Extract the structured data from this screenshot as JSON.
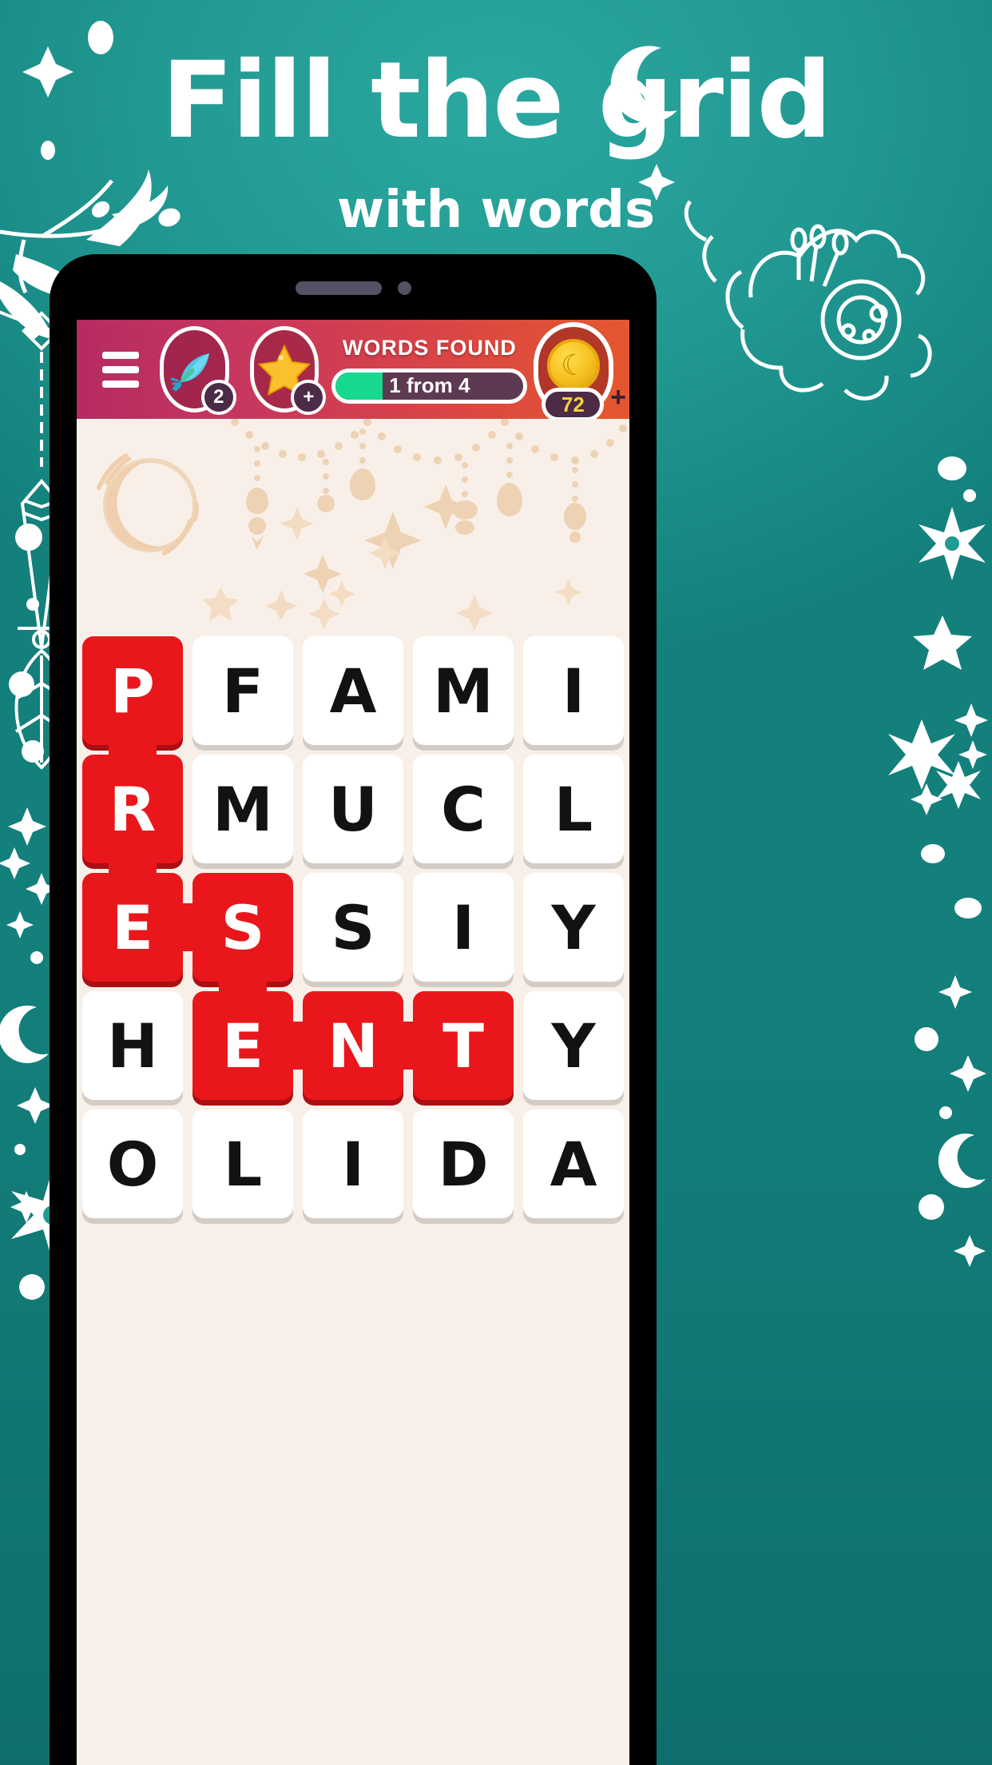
{
  "promo": {
    "title_line1": "Fill the grid",
    "title_line2": "with words",
    "background_color": "#219a93",
    "accent_white": "#ffffff"
  },
  "game": {
    "topbar": {
      "menu_icon": "hamburger-icon",
      "feather_powerup": {
        "icon": "feather-icon",
        "count": "2"
      },
      "star_powerup": {
        "icon": "star-icon",
        "badge": "+"
      },
      "words_found_label": "WORDS FOUND",
      "progress_text": "1 from 4",
      "progress_percent": 25,
      "progress_fill_color": "#17d98e",
      "coins": {
        "icon": "coin-moon-icon",
        "amount": "72",
        "add_label": "+"
      }
    },
    "board": {
      "decor_moon": "crescent-moon-decoration",
      "decor_garland": "hanging-beads-decoration",
      "columns": 5,
      "rows": 5,
      "found_color": "#e9171b",
      "tile_color": "#ffffff",
      "grid": [
        [
          {
            "letter": "P",
            "found": true,
            "join_right": false,
            "join_down": true
          },
          {
            "letter": "F",
            "found": false,
            "join_right": false,
            "join_down": false
          },
          {
            "letter": "A",
            "found": false,
            "join_right": false,
            "join_down": false
          },
          {
            "letter": "M",
            "found": false,
            "join_right": false,
            "join_down": false
          },
          {
            "letter": "I",
            "found": false,
            "join_right": false,
            "join_down": false
          }
        ],
        [
          {
            "letter": "R",
            "found": true,
            "join_right": false,
            "join_down": true
          },
          {
            "letter": "M",
            "found": false,
            "join_right": false,
            "join_down": false
          },
          {
            "letter": "U",
            "found": false,
            "join_right": false,
            "join_down": false
          },
          {
            "letter": "C",
            "found": false,
            "join_right": false,
            "join_down": false
          },
          {
            "letter": "L",
            "found": false,
            "join_right": false,
            "join_down": false
          }
        ],
        [
          {
            "letter": "E",
            "found": true,
            "join_right": true,
            "join_down": false
          },
          {
            "letter": "S",
            "found": true,
            "join_right": false,
            "join_down": true
          },
          {
            "letter": "S",
            "found": false,
            "join_right": false,
            "join_down": false
          },
          {
            "letter": "I",
            "found": false,
            "join_right": false,
            "join_down": false
          },
          {
            "letter": "Y",
            "found": false,
            "join_right": false,
            "join_down": false
          }
        ],
        [
          {
            "letter": "H",
            "found": false,
            "join_right": false,
            "join_down": false
          },
          {
            "letter": "E",
            "found": true,
            "join_right": true,
            "join_down": false
          },
          {
            "letter": "N",
            "found": true,
            "join_right": true,
            "join_down": false
          },
          {
            "letter": "T",
            "found": true,
            "join_right": false,
            "join_down": false
          },
          {
            "letter": "Y",
            "found": false,
            "join_right": false,
            "join_down": false
          }
        ],
        [
          {
            "letter": "O",
            "found": false,
            "join_right": false,
            "join_down": false
          },
          {
            "letter": "L",
            "found": false,
            "join_right": false,
            "join_down": false
          },
          {
            "letter": "I",
            "found": false,
            "join_right": false,
            "join_down": false
          },
          {
            "letter": "D",
            "found": false,
            "join_right": false,
            "join_down": false
          },
          {
            "letter": "A",
            "found": false,
            "join_right": false,
            "join_down": false
          }
        ]
      ]
    }
  }
}
